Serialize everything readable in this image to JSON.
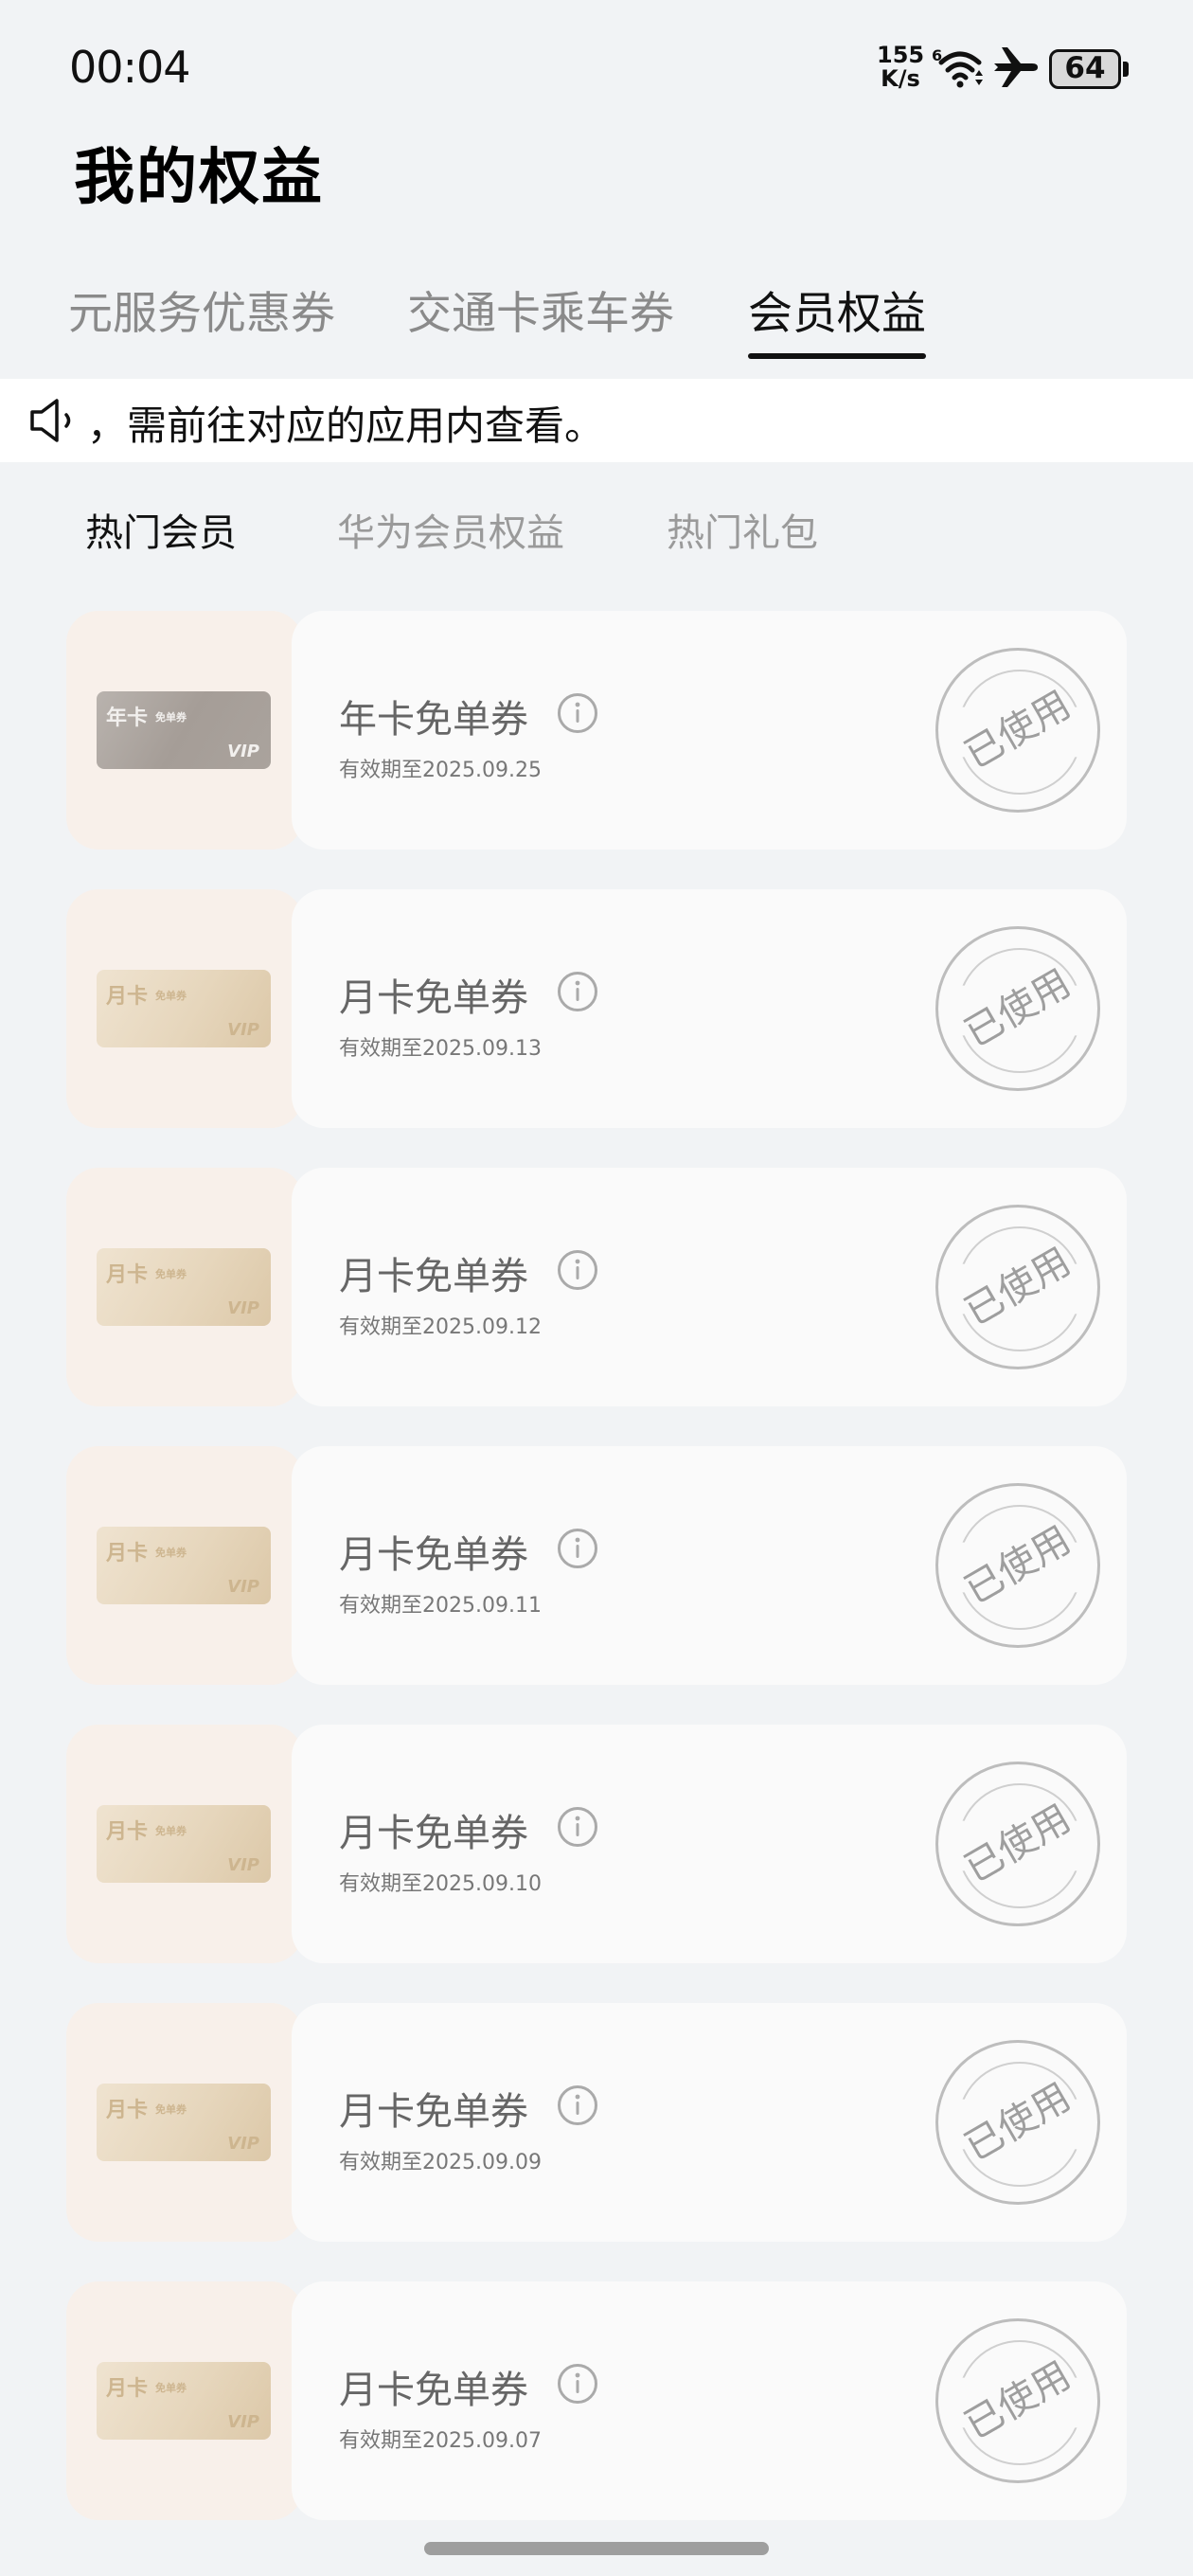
{
  "status_bar": {
    "time": "00:04",
    "net_speed_value": "155",
    "net_speed_unit": "K/s",
    "wifi_label": "6",
    "battery": "64"
  },
  "page": {
    "title": "我的权益"
  },
  "top_tabs": [
    {
      "label": "元服务优惠券",
      "active": false
    },
    {
      "label": "交通卡乘车券",
      "active": false
    },
    {
      "label": "会员权益",
      "active": true
    }
  ],
  "notice": {
    "text": "，需前往对应的应用内查看。"
  },
  "sub_tabs": [
    {
      "label": "热门会员",
      "active": true
    },
    {
      "label": "华为会员权益",
      "active": false
    },
    {
      "label": "热门礼包",
      "active": false
    }
  ],
  "coupons": [
    {
      "card_title": "年卡",
      "card_sub": "免单券",
      "card_vip": "VIP",
      "name": "年卡免单券",
      "expiry": "有效期至2025.09.25",
      "status": "已使用"
    },
    {
      "card_title": "月卡",
      "card_sub": "免单券",
      "card_vip": "VIP",
      "name": "月卡免单券",
      "expiry": "有效期至2025.09.13",
      "status": "已使用"
    },
    {
      "card_title": "月卡",
      "card_sub": "免单券",
      "card_vip": "VIP",
      "name": "月卡免单券",
      "expiry": "有效期至2025.09.12",
      "status": "已使用"
    },
    {
      "card_title": "月卡",
      "card_sub": "免单券",
      "card_vip": "VIP",
      "name": "月卡免单券",
      "expiry": "有效期至2025.09.11",
      "status": "已使用"
    },
    {
      "card_title": "月卡",
      "card_sub": "免单券",
      "card_vip": "VIP",
      "name": "月卡免单券",
      "expiry": "有效期至2025.09.10",
      "status": "已使用"
    },
    {
      "card_title": "月卡",
      "card_sub": "免单券",
      "card_vip": "VIP",
      "name": "月卡免单券",
      "expiry": "有效期至2025.09.09",
      "status": "已使用"
    },
    {
      "card_title": "月卡",
      "card_sub": "免单券",
      "card_vip": "VIP",
      "name": "月卡免单券",
      "expiry": "有效期至2025.09.07",
      "status": "已使用"
    }
  ]
}
